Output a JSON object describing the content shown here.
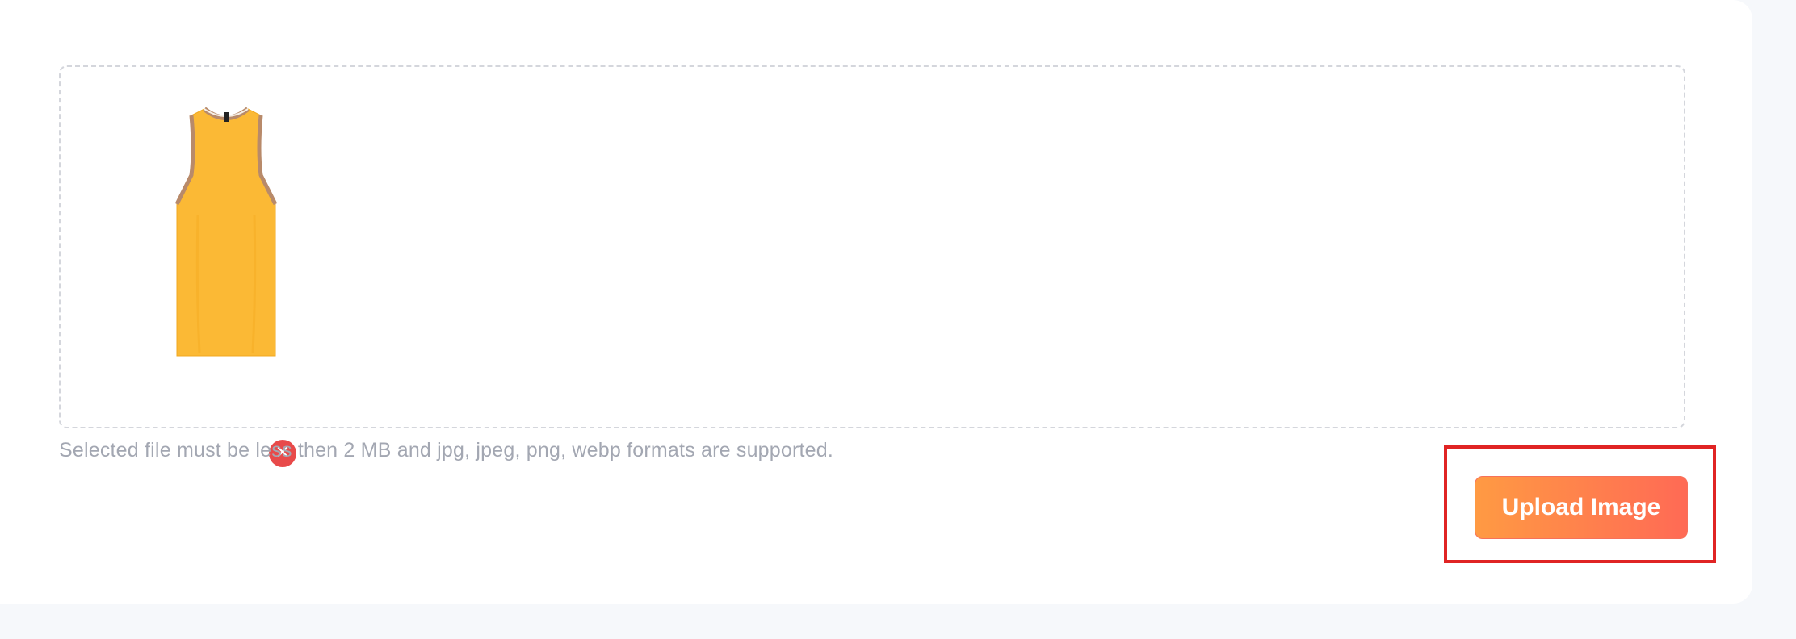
{
  "upload": {
    "hint_text": "Selected file must be less then 2 MB and jpg, jpeg, png, webp formats are supported.",
    "button_label": "Upload Image",
    "remove_icon": "close-icon",
    "preview_item": "yellow-tank-top"
  },
  "colors": {
    "accent_start": "#ff9a43",
    "accent_end": "#ff6a55",
    "remove": "#e84a4a",
    "highlight": "#e02424"
  }
}
